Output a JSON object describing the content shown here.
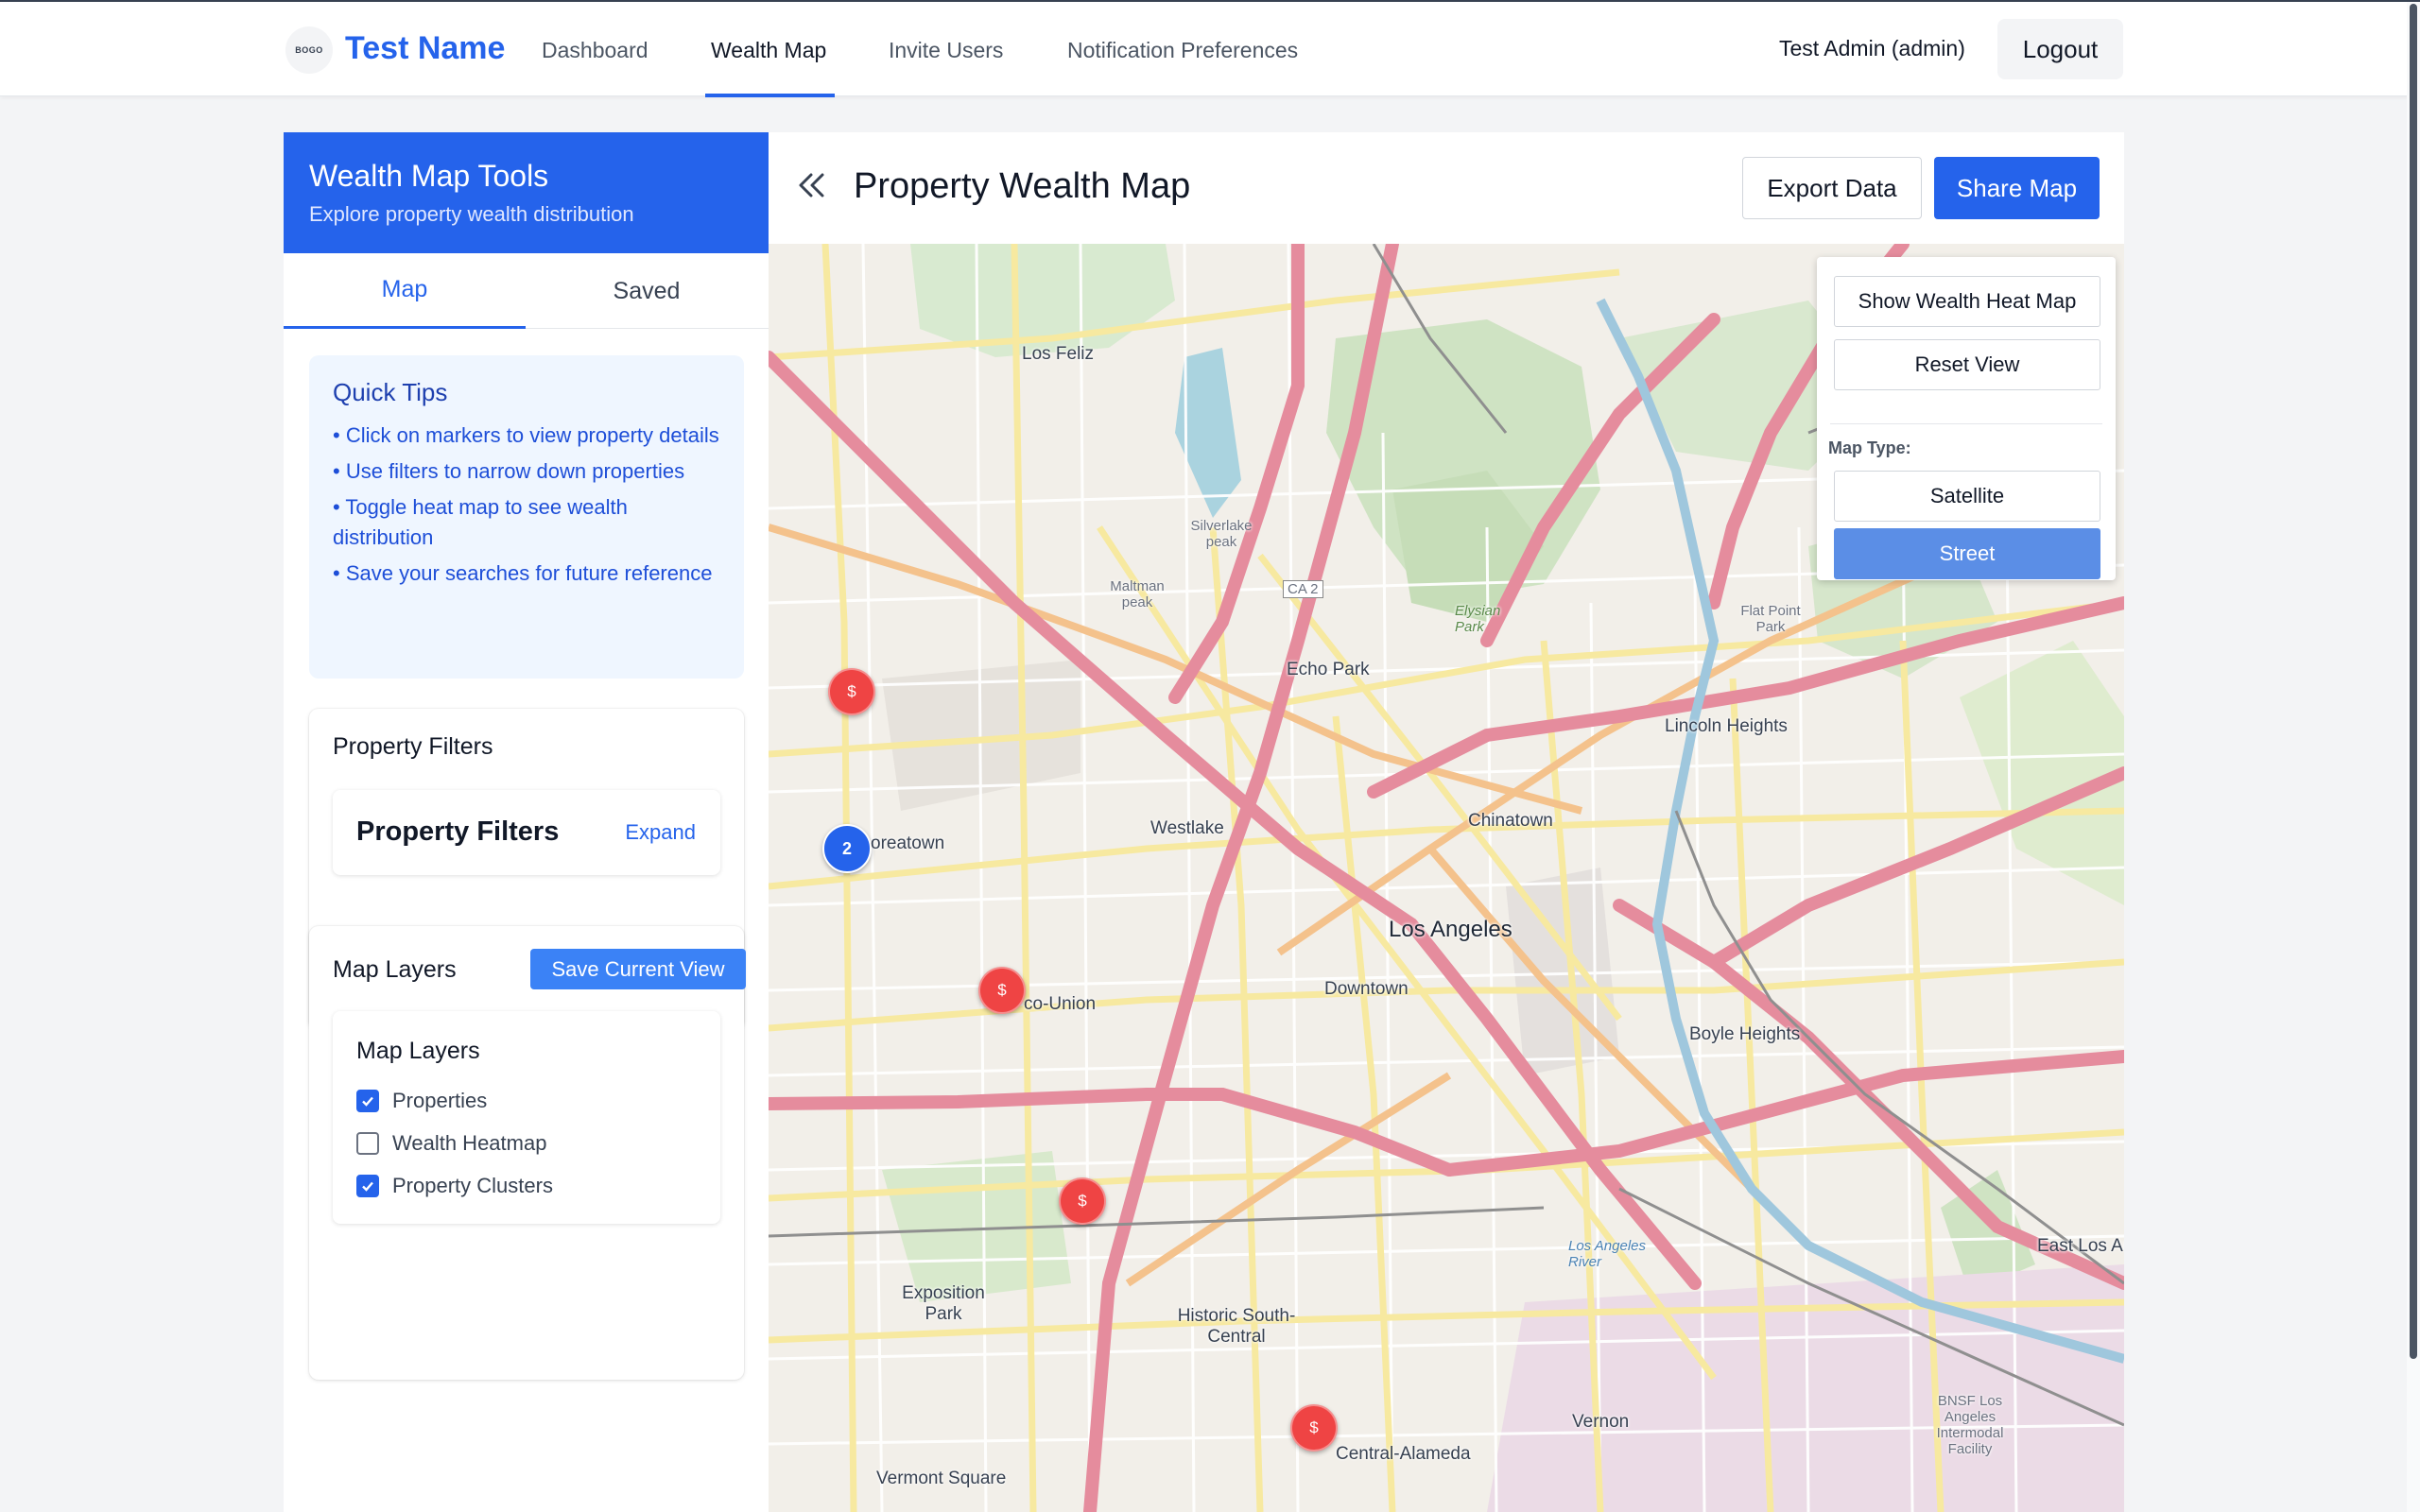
{
  "nav": {
    "logo_text": "BOGO",
    "brand": "Test Name",
    "links": [
      {
        "label": "Dashboard",
        "active": false
      },
      {
        "label": "Wealth Map",
        "active": true
      },
      {
        "label": "Invite Users",
        "active": false
      },
      {
        "label": "Notification Preferences",
        "active": false
      }
    ],
    "user": "Test Admin (admin)",
    "logout": "Logout"
  },
  "sidebar": {
    "title": "Wealth Map Tools",
    "subtitle": "Explore property wealth distribution",
    "tabs": [
      {
        "label": "Map",
        "active": true
      },
      {
        "label": "Saved",
        "active": false
      }
    ],
    "tips": {
      "title": "Quick Tips",
      "items": [
        "• Click on markers to view property details",
        "• Use filters to narrow down properties",
        "• Toggle heat map to see wealth distribution",
        "• Save your searches for future reference"
      ]
    },
    "filters": {
      "card_title": "Property Filters",
      "inner_title": "Property Filters",
      "expand": "Expand"
    },
    "layers": {
      "card_title": "Map Layers",
      "save_view": "Save Current View",
      "inner_title": "Map Layers",
      "items": [
        {
          "label": "Properties",
          "checked": true
        },
        {
          "label": "Wealth Heatmap",
          "checked": false
        },
        {
          "label": "Property Clusters",
          "checked": true
        }
      ]
    }
  },
  "main": {
    "title": "Property Wealth Map",
    "export": "Export Data",
    "share": "Share Map",
    "controls": {
      "heat_map": "Show Wealth Heat Map",
      "reset": "Reset View",
      "map_type_label": "Map Type:",
      "satellite": "Satellite",
      "street": "Street",
      "selected_type": "Street"
    },
    "markers": {
      "symbol": "$",
      "cluster_count": "2"
    },
    "map_labels": {
      "los_feliz": "Los Feliz",
      "silverlake_peak": "Silverlake peak",
      "maltman_peak": "Maltman peak",
      "ca2": "CA 2",
      "echo_park": "Echo Park",
      "elysian_park": "Elysian Park",
      "flat_point_park": "Flat Point Park",
      "lincoln_heights": "Lincoln Heights",
      "westlake": "Westlake",
      "chinatown": "Chinatown",
      "koreatown": "oreatown",
      "los_angeles": "Los Angeles",
      "downtown": "Downtown",
      "pico_union": "co-Union",
      "boyle_heights": "Boyle Heights",
      "exposition_park": "Exposition Park",
      "historic_south_central": "Historic South-Central",
      "east_los_angeles": "East Los Ange",
      "vernon": "Vernon",
      "central_alameda": "Central-Alameda",
      "vermont_square": "Vermont Square",
      "la_river": "Los Angeles River",
      "bnsf": "BNSF Los Angeles Intermodal Facility"
    }
  }
}
